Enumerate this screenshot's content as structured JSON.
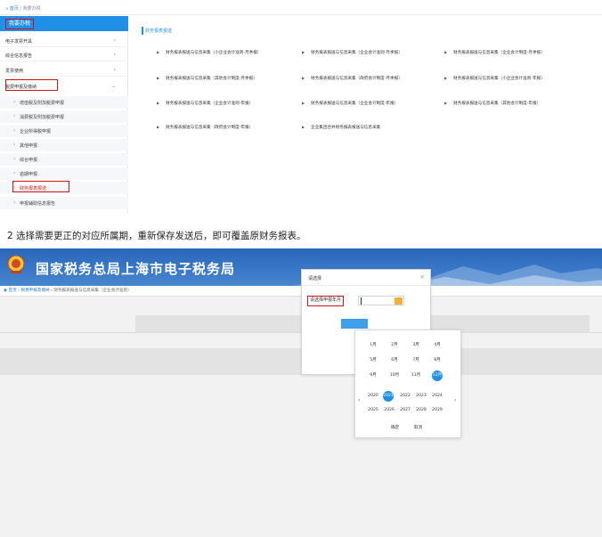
{
  "shot1": {
    "breadcrumb": {
      "home": "首页",
      "separator": "/",
      "current": "我要办税"
    },
    "sidebar": {
      "header": "我要办税",
      "items": [
        {
          "label": "电子发票开具",
          "chevron": "›"
        },
        {
          "label": "综合信息报告",
          "chevron": "›"
        },
        {
          "label": "发票使用",
          "chevron": "›"
        },
        {
          "label": "税费申报及缴纳",
          "chevron": "⌄"
        }
      ],
      "subitems": [
        {
          "label": "增值税及附加税费申报"
        },
        {
          "label": "消费税及附加税费申报"
        },
        {
          "label": "企业所得税申报"
        },
        {
          "label": "其他申报"
        },
        {
          "label": "综合申报"
        },
        {
          "label": "逾期申报"
        },
        {
          "label": "财务报表报送"
        },
        {
          "label": "申报辅助信息报告"
        }
      ]
    },
    "main": {
      "section_title": "财务报表报送",
      "links": [
        "财务报表报送与信息采集（小企业会计准则-月季报）",
        "财务报表报送与信息采集（企业会计准则-月季报）",
        "财务报表报送与信息采集（企业会计制度-月季报）",
        "财务报表报送与信息采集（其他会计制度-月季报）",
        "财务报表报送与信息采集（政府会计制度-月季报）",
        "财务报表报送与信息采集（小企业会计准则-年报）",
        "财务报表报送与信息采集（企业会计准则-年报）",
        "财务报表报送与信息采集（企业会计制度-年报）",
        "财务报表报送与信息采集（其他会计制度-年报）",
        "财务报表报送与信息采集（政府会计制度-年报）",
        "企业集团合并财务报表报送与信息采集"
      ]
    }
  },
  "caption": "2 选择需要更正的对应所属期，重新保存发送后，即可覆盖原财务报表。",
  "shot2": {
    "banner_title": "国家税务总局上海市电子税务局",
    "breadcrumb": {
      "home": "首页",
      "level2": "税费申报及缴纳",
      "current": "财务报表报送与信息采集（企业会计准则）"
    },
    "dialog": {
      "title": "请选择",
      "close": "×",
      "field_label": "请选择申报年月"
    },
    "picker": {
      "months": [
        "1月",
        "2月",
        "3月",
        "4月",
        "5月",
        "6月",
        "7月",
        "8月",
        "9月",
        "10月",
        "11月",
        "12月"
      ],
      "selected_month": "12月",
      "years": [
        "2020",
        "2021",
        "2022",
        "2023",
        "2024",
        "2025",
        "2026",
        "2027",
        "2028",
        "2029"
      ],
      "selected_year": "2021",
      "prev": "‹",
      "next": "›",
      "confirm": "确定",
      "cancel": "取消"
    }
  },
  "colors": {
    "primary_blue": "#1f8fe7",
    "highlight_red": "#d0121b",
    "banner_blue": "#2a66b8"
  }
}
